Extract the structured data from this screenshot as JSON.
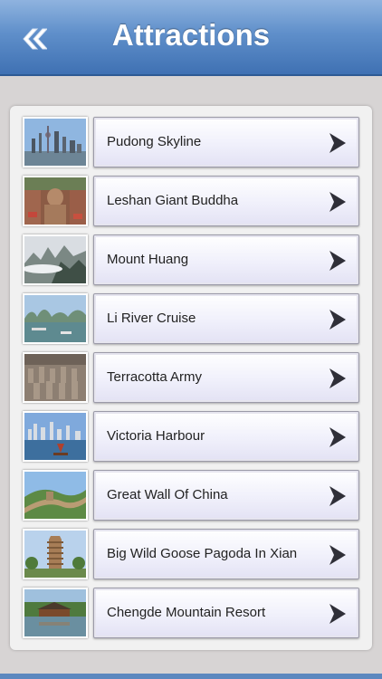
{
  "header": {
    "title": "Attractions",
    "back_icon": "double-chevron-left-icon"
  },
  "attractions": [
    {
      "label": "Pudong Skyline"
    },
    {
      "label": "Leshan Giant Buddha"
    },
    {
      "label": "Mount Huang"
    },
    {
      "label": "Li River Cruise"
    },
    {
      "label": "Terracotta Army"
    },
    {
      "label": "Victoria Harbour"
    },
    {
      "label": "Great Wall Of China"
    },
    {
      "label": "Big Wild Goose Pagoda In Xian"
    },
    {
      "label": "Chengde Mountain Resort"
    }
  ],
  "colors": {
    "navbar": "#5f8fca",
    "chevron": "#2f2f38",
    "background": "#d7d4d4"
  }
}
